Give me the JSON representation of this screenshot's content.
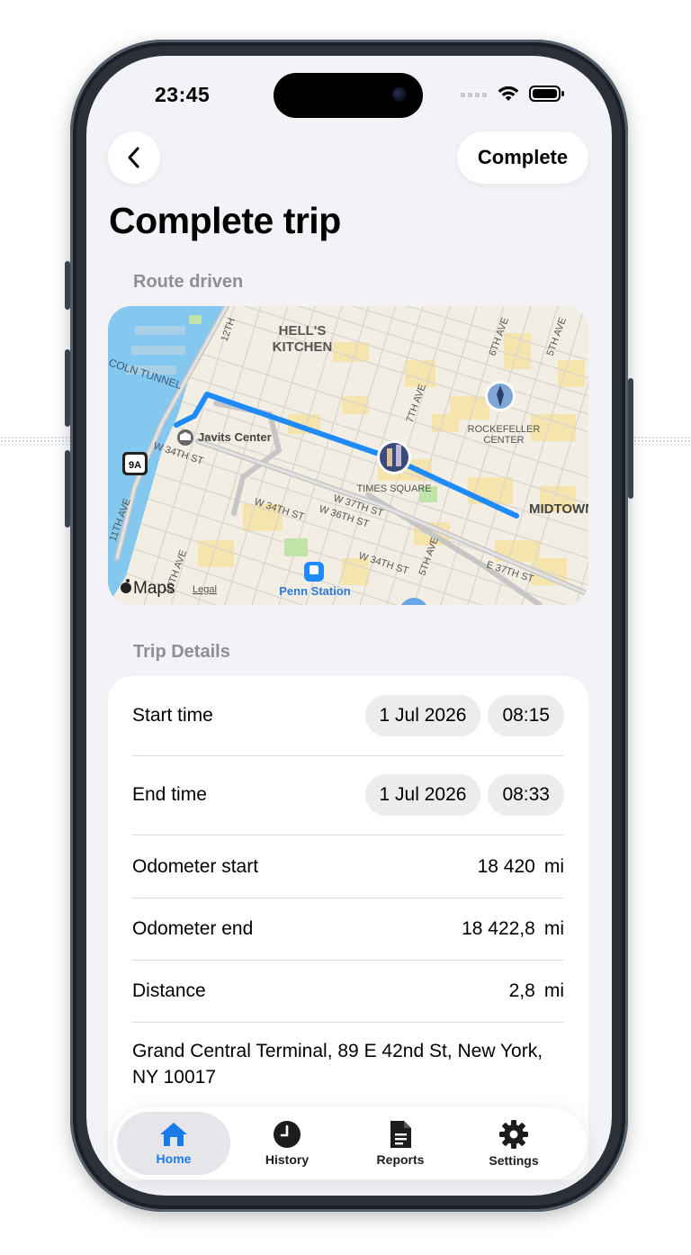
{
  "status_bar": {
    "time": "23:45"
  },
  "header": {
    "complete_label": "Complete",
    "title": "Complete trip"
  },
  "route": {
    "section_label": "Route driven",
    "map_labels": {
      "hells_kitchen_1": "HELL'S",
      "hells_kitchen_2": "KITCHEN",
      "rockefeller_1": "ROCKEFELLER",
      "rockefeller_2": "CENTER",
      "javits": "Javits Center",
      "times_square": "TIMES SQUARE",
      "midtown": "MIDTOWN",
      "penn": "Penn Station",
      "tunnel": "COLN TUNNEL",
      "w34": "W 34TH ST",
      "w34b": "W 34TH ST",
      "w36": "W 36TH ST",
      "w37": "W 37TH ST",
      "w34c": "W 34TH ST",
      "e37": "E 37TH ST",
      "ave6": "6TH AVE",
      "ave5": "5TH AVE",
      "ave5b": "5TH AVE",
      "ave7": "7TH AVE",
      "ave11": "11TH AVE",
      "ave10": "10TH AVE",
      "ave12": "12TH",
      "route9a": "9A",
      "maps_brand": "Maps",
      "legal": "Legal"
    }
  },
  "trip_details": {
    "section_label": "Trip Details",
    "start_time": {
      "label": "Start time",
      "date": "1 Jul 2026",
      "time": "08:15"
    },
    "end_time": {
      "label": "End time",
      "date": "1 Jul 2026",
      "time": "08:33"
    },
    "odometer_start": {
      "label": "Odometer start",
      "value": "18 420",
      "unit": "mi"
    },
    "odometer_end": {
      "label": "Odometer end",
      "value": "18 422,8",
      "unit": "mi"
    },
    "distance": {
      "label": "Distance",
      "value": "2,8",
      "unit": "mi"
    },
    "address": "Grand Central Terminal, 89 E 42nd St, New York, NY 10017"
  },
  "tab_bar": {
    "tabs": [
      {
        "label": "Home",
        "icon": "house-icon",
        "active": true
      },
      {
        "label": "History",
        "icon": "clock-icon",
        "active": false
      },
      {
        "label": "Reports",
        "icon": "document-icon",
        "active": false
      },
      {
        "label": "Settings",
        "icon": "gear-icon",
        "active": false
      }
    ]
  },
  "colors": {
    "accent": "#1a7ae8",
    "route": "#1f8bff",
    "background": "#f2f2f7"
  }
}
